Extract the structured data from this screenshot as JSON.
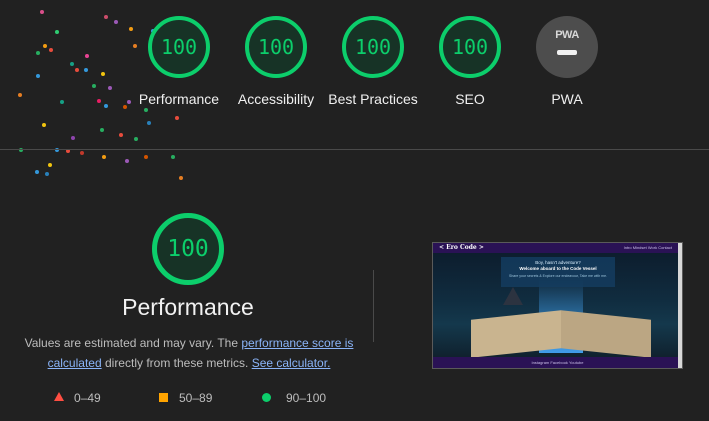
{
  "categories": [
    {
      "label": "Performance",
      "score": "100"
    },
    {
      "label": "Accessibility",
      "score": "100"
    },
    {
      "label": "Best Practices",
      "score": "100"
    },
    {
      "label": "SEO",
      "score": "100"
    }
  ],
  "pwa": {
    "label": "PWA",
    "badge_text": "PWA"
  },
  "detail": {
    "score": "100",
    "title": "Performance",
    "desc_prefix": "Values are estimated and may vary. The ",
    "link_score": "performance score is calculated",
    "desc_middle": " directly from these metrics. ",
    "link_calculator": "See calculator."
  },
  "legend": [
    {
      "range": "0–49",
      "color": "#ff4e42",
      "shape": "triangle"
    },
    {
      "range": "50–89",
      "color": "#ffa400",
      "shape": "square"
    },
    {
      "range": "90–100",
      "color": "#0cce6b",
      "shape": "circle"
    }
  ],
  "screenshot": {
    "logo": "< Ero Code >",
    "nav_links": "Intro  Mindset  Work  Contact",
    "headline_1": "Boy, hasn't adventure?",
    "headline_2": "Welcome aboard to the Code Vessel",
    "subtext": "Share your secrets & Explore our endeavour, Take me with me.",
    "footer": "Instagram  Facebook  Youtube"
  },
  "colors": {
    "pass": "#0cce6b",
    "background": "#212121"
  }
}
